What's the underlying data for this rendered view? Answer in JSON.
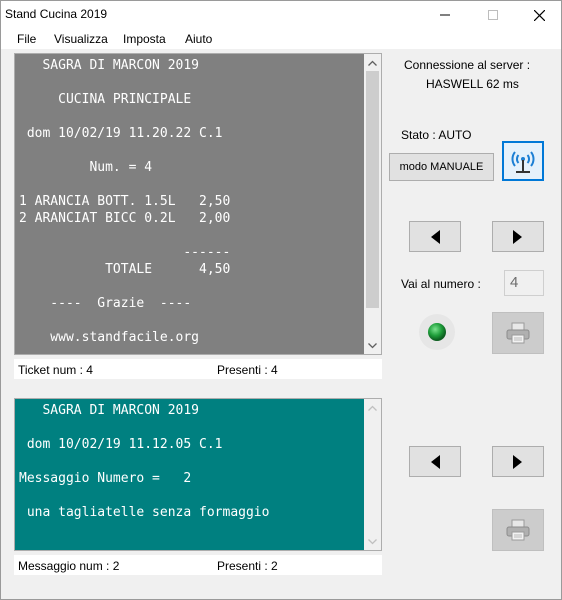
{
  "window": {
    "title": "Stand Cucina 2019"
  },
  "menu": [
    "File",
    "Visualizza",
    "Imposta",
    "Aiuto"
  ],
  "ticket": {
    "lines": [
      "   SAGRA DI MARCON 2019",
      "",
      "     CUCINA PRINCIPALE",
      "",
      " dom 10/02/19 11.20.22 C.1",
      "",
      "         Num. = 4",
      "",
      "1 ARANCIA BOTT. 1.5L   2,50",
      "2 ARANCIAT BICC 0.2L   2,00",
      "",
      "                     ------",
      "           TOTALE      4,50",
      "",
      "    ----  Grazie  ----",
      "",
      "    www.standfacile.org"
    ],
    "status_left": "Ticket num : 4",
    "status_right": "Presenti : 4"
  },
  "message": {
    "lines": [
      "   SAGRA DI MARCON 2019",
      "",
      " dom 10/02/19 11.12.05 C.1",
      "",
      "Messaggio Numero =   2",
      "",
      " una tagliatelle senza formaggio"
    ],
    "status_left": "Messaggio num : 2",
    "status_right": "Presenti : 2"
  },
  "right_panel": {
    "connection_label": "Connessione al server :",
    "server_value": "HASWELL 62 ms",
    "stato_label": "Stato : AUTO",
    "mode_button_label": "modo MANUALE",
    "goto_label": "Vai al numero :",
    "goto_value": "4"
  },
  "colors": {
    "ticket_bg": "#808080",
    "message_bg": "#008080",
    "led": "#1e9d3a",
    "antenna": "#1c7fd4"
  }
}
